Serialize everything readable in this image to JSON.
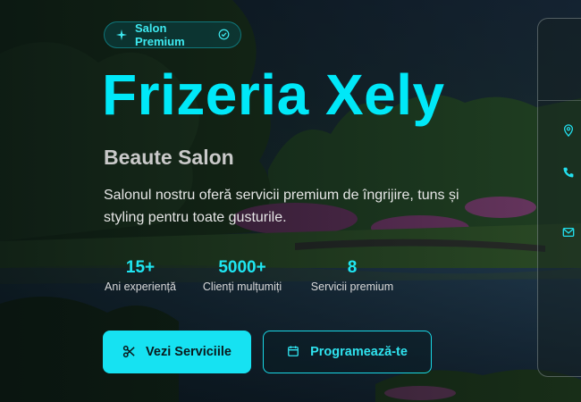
{
  "hero": {
    "badge": {
      "label": "Salon Premium",
      "icon_left": "sparkle-icon",
      "icon_right": "verified-icon"
    },
    "title": "Frizeria Xely",
    "subtitle": "Beaute Salon",
    "description": "Salonul nostru oferă servicii premium de îngrijire, tuns și styling pentru toate gusturile.",
    "stats": [
      {
        "value": "15+",
        "label": "Ani experiență"
      },
      {
        "value": "5000+",
        "label": "Clienți mulțumiți"
      },
      {
        "value": "8",
        "label": "Servicii premium"
      }
    ],
    "buttons": {
      "primary": {
        "label": "Vezi Serviciile",
        "icon": "scissors-icon"
      },
      "secondary": {
        "label": "Programează-te",
        "icon": "calendar-icon"
      }
    }
  },
  "side_panel": {
    "icons": [
      "location-pin-icon",
      "phone-icon",
      "mail-icon"
    ]
  },
  "colors": {
    "accent": "#16e2f2",
    "title": "#00e8f8",
    "subtitle": "#c9c9c9"
  }
}
